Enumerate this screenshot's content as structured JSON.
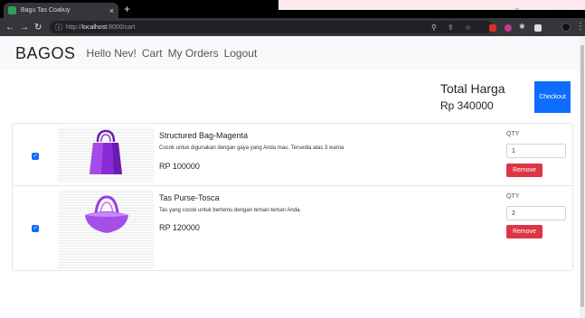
{
  "browser": {
    "tab_title": "Bagu Tas Coaliuy",
    "new_tab": "+",
    "url_prefix": "http://",
    "url_host": "localhost",
    "url_path": ":8000/cart",
    "minimize": "–",
    "maximize": "❐",
    "close": "✕"
  },
  "navbar": {
    "brand": "BAGOS",
    "links": [
      "Hello Nev!",
      "Cart",
      "My Orders",
      "Logout"
    ]
  },
  "summary": {
    "total_label": "Total Harga",
    "total_value": "Rp 340000",
    "checkout_label": "Checkout"
  },
  "cart": {
    "items": [
      {
        "name": "Structured Bag-Magenta",
        "description": "Cocok untuk digunakan dengan gaya yang Anda mau. Tersedia atas 3 warna",
        "price": "RP 100000",
        "qty_label": "QTY",
        "qty": "1",
        "remove_label": "Remove",
        "checked": true
      },
      {
        "name": "Tas Purse-Tosca",
        "description": "Tas yang cocok untuk bertemu dengan teman-teman Anda.",
        "price": "RP 120000",
        "qty_label": "QTY",
        "qty": "2",
        "remove_label": "Remove",
        "checked": true
      }
    ]
  },
  "colors": {
    "primary": "#0d6efd",
    "danger": "#dc3545",
    "navbar_bg": "#f8f9fa"
  }
}
